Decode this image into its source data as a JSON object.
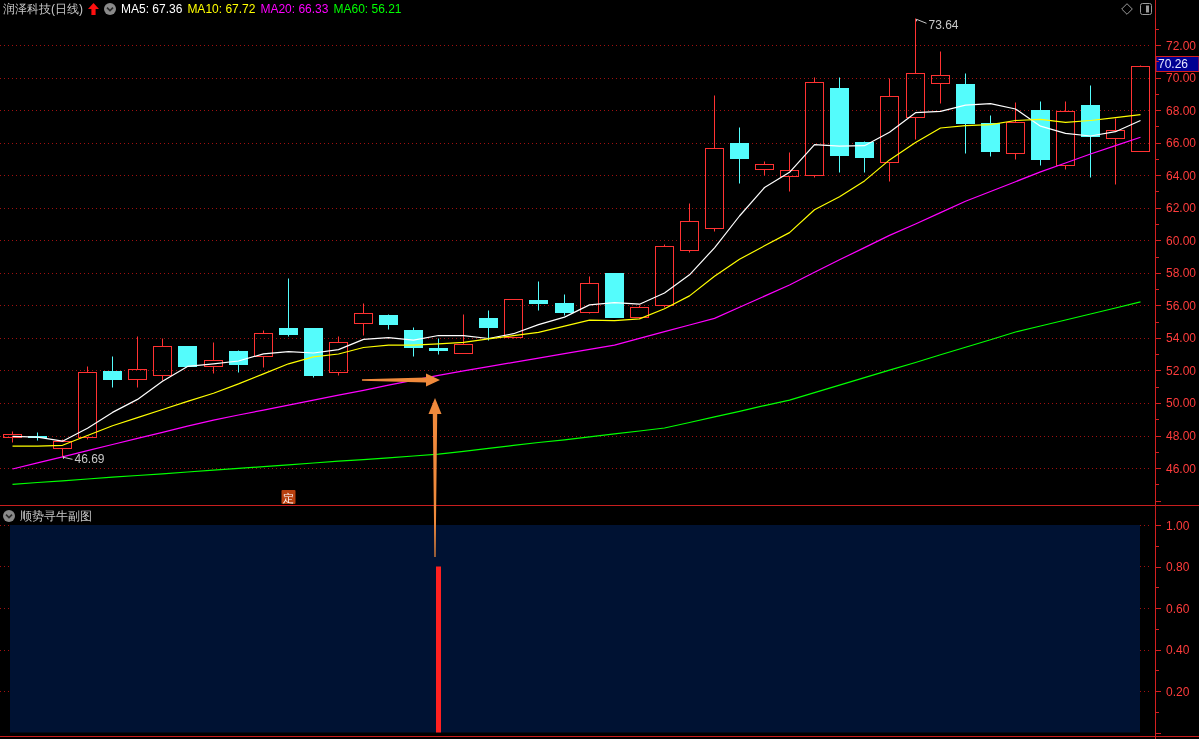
{
  "header": {
    "title": "润泽科技(日线)",
    "indicators": [
      {
        "label": "MA5: 67.36",
        "color": "#ffffff"
      },
      {
        "label": "MA10: 67.72",
        "color": "#ffff00"
      },
      {
        "label": "MA20: 66.33",
        "color": "#ff00ff"
      },
      {
        "label": "MA60: 56.21",
        "color": "#00ff00"
      }
    ]
  },
  "main_chart": {
    "chart_data": {
      "type": "candlestick",
      "grid": true,
      "ylim": [
        43.73,
        73.66
      ],
      "yticks": [
        {
          "value": 72,
          "label": "72.00"
        },
        {
          "value": 70,
          "label": "70.00"
        },
        {
          "value": 68,
          "label": "68.00"
        },
        {
          "value": 66,
          "label": "66.00"
        },
        {
          "value": 64,
          "label": "64.00"
        },
        {
          "value": 62,
          "label": "62.00"
        },
        {
          "value": 60,
          "label": "60.00"
        },
        {
          "value": 58,
          "label": "58.00"
        },
        {
          "value": 56,
          "label": "56.00"
        },
        {
          "value": 54,
          "label": "54.00"
        },
        {
          "value": 52,
          "label": "52.00"
        },
        {
          "value": 50,
          "label": "50.00"
        },
        {
          "value": 48,
          "label": "48.00"
        },
        {
          "value": 46,
          "label": "46.00"
        }
      ],
      "ohlc": [
        [
          47.9,
          48.3,
          47.6,
          48.1
        ],
        [
          48.0,
          48.2,
          47.7,
          47.95
        ],
        [
          47.25,
          47.8,
          46.69,
          47.65
        ],
        [
          47.9,
          52.3,
          47.8,
          51.9
        ],
        [
          51.95,
          52.9,
          51.0,
          51.5
        ],
        [
          51.5,
          54.1,
          51.0,
          52.1
        ],
        [
          51.7,
          54.0,
          51.4,
          53.5
        ],
        [
          53.5,
          53.5,
          52.27,
          52.27
        ],
        [
          52.27,
          53.74,
          51.84,
          52.64
        ],
        [
          53.2,
          53.25,
          51.9,
          52.4
        ],
        [
          52.9,
          54.48,
          52.2,
          54.3
        ],
        [
          54.6,
          57.68,
          54.1,
          54.24
        ],
        [
          54.6,
          54.6,
          51.6,
          51.7
        ],
        [
          51.9,
          54.1,
          51.7,
          53.74
        ],
        [
          54.94,
          56.14,
          54.17,
          55.53
        ],
        [
          55.4,
          55.45,
          54.55,
          54.85
        ],
        [
          54.5,
          54.66,
          52.9,
          53.45
        ],
        [
          53.35,
          54.0,
          53.0,
          53.28
        ],
        [
          53.1,
          55.47,
          53.05,
          53.62
        ],
        [
          55.2,
          55.7,
          53.87,
          54.67
        ],
        [
          54.05,
          56.4,
          54.0,
          56.4
        ],
        [
          56.35,
          57.5,
          55.74,
          56.17
        ],
        [
          56.14,
          56.7,
          55.4,
          55.6
        ],
        [
          55.6,
          57.8,
          55.5,
          57.37
        ],
        [
          57.98,
          58.0,
          55.3,
          55.3
        ],
        [
          55.28,
          56.0,
          55.2,
          55.91
        ],
        [
          56.0,
          59.8,
          55.9,
          59.64
        ],
        [
          59.4,
          62.3,
          59.3,
          61.18
        ],
        [
          60.75,
          68.9,
          60.6,
          65.67
        ],
        [
          65.98,
          66.96,
          63.5,
          65.05
        ],
        [
          64.38,
          64.9,
          64.0,
          64.68
        ],
        [
          63.95,
          65.4,
          63.0,
          64.3
        ],
        [
          64.0,
          70.03,
          63.9,
          69.7
        ],
        [
          69.36,
          70.03,
          64.2,
          65.24
        ],
        [
          66.04,
          66.1,
          64.2,
          65.12
        ],
        [
          64.79,
          69.99,
          63.64,
          68.84
        ],
        [
          67.55,
          73.64,
          66.24,
          70.28
        ],
        [
          69.64,
          71.63,
          68.41,
          70.13
        ],
        [
          69.6,
          70.3,
          65.38,
          67.2
        ],
        [
          67.2,
          67.7,
          65.18,
          65.48
        ],
        [
          65.38,
          68.5,
          65.0,
          67.25
        ],
        [
          68.0,
          68.56,
          64.64,
          65.0
        ],
        [
          64.6,
          68.56,
          64.4,
          67.92
        ],
        [
          68.31,
          69.54,
          63.9,
          66.4
        ],
        [
          66.26,
          67.5,
          63.44,
          66.77
        ],
        [
          65.47,
          70.75,
          65.47,
          70.7
        ]
      ],
      "series": [
        {
          "type": "line",
          "color": "#ffffff",
          "values": [
            47.95,
            47.9,
            47.65,
            48.45,
            49.42,
            50.22,
            51.33,
            52.25,
            52.4,
            52.58,
            53.02,
            53.16,
            53.07,
            53.28,
            53.91,
            54.02,
            53.86,
            54.15,
            54.14,
            53.96,
            54.26,
            54.82,
            55.28,
            56.03,
            56.16,
            56.07,
            56.76,
            57.88,
            59.54,
            61.49,
            63.24,
            64.18,
            65.88,
            65.79,
            65.81,
            66.64,
            67.84,
            67.92,
            68.31,
            68.39,
            68.07,
            67.01,
            66.57,
            66.41,
            66.67,
            67.36
          ]
        },
        {
          "type": "line",
          "color": "#ffff00",
          "values": [
            47.35,
            47.35,
            47.4,
            48.0,
            48.6,
            49.1,
            49.6,
            50.1,
            50.6,
            51.17,
            51.79,
            52.41,
            52.83,
            53.01,
            53.41,
            53.56,
            53.55,
            53.64,
            53.73,
            53.94,
            54.14,
            54.34,
            54.72,
            55.09,
            55.06,
            55.17,
            55.79,
            56.58,
            57.79,
            58.83,
            59.66,
            60.47,
            61.88,
            62.67,
            63.65,
            64.94,
            66.01,
            66.9,
            67.05,
            67.1,
            67.36,
            67.43,
            67.25,
            67.36,
            67.53,
            67.72
          ]
        },
        {
          "type": "line",
          "color": "#ff00ff",
          "values": [
            45.94,
            46.32,
            46.69,
            47.07,
            47.45,
            47.83,
            48.2,
            48.58,
            48.95,
            49.26,
            49.56,
            49.87,
            50.17,
            50.48,
            50.78,
            51.09,
            null,
            51.7,
            51.97,
            52.23,
            52.5,
            52.76,
            53.03,
            53.3,
            53.56,
            53.97,
            54.38,
            54.79,
            55.2,
            55.88,
            56.57,
            57.25,
            58.03,
            58.8,
            59.55,
            60.3,
            61.0,
            61.7,
            62.4,
            63.0,
            63.6,
            64.2,
            64.75,
            65.3,
            65.82,
            66.33
          ]
        },
        {
          "type": "line",
          "color": "#00ff00",
          "values": [
            45.0,
            45.11,
            45.22,
            45.33,
            45.44,
            45.54,
            45.65,
            45.76,
            45.87,
            45.98,
            46.09,
            46.2,
            46.31,
            46.42,
            46.52,
            46.63,
            46.74,
            46.85,
            47.03,
            47.21,
            47.39,
            47.57,
            47.74,
            47.92,
            48.1,
            48.28,
            48.46,
            48.8,
            49.15,
            49.49,
            49.84,
            50.18,
            50.64,
            51.1,
            51.56,
            52.02,
            52.49,
            52.96,
            53.42,
            53.89,
            54.36,
            54.73,
            55.1,
            55.47,
            55.84,
            56.21
          ]
        }
      ]
    },
    "high_label": "73.64",
    "low_label": "46.69",
    "price_tag": "70.26",
    "marker_tag": "定"
  },
  "sub_chart": {
    "title": "顺势寻牛副图",
    "chart_data": {
      "type": "bar",
      "grid": true,
      "ylim": [
        0,
        1
      ],
      "yticks": [
        {
          "value": 1,
          "label": "1.00"
        },
        {
          "value": 0.8,
          "label": "0.80"
        },
        {
          "value": 0.6,
          "label": "0.60"
        },
        {
          "value": 0.4,
          "label": "0.40"
        },
        {
          "value": 0.2,
          "label": "0.20"
        }
      ],
      "series": [
        {
          "color": "#ff2020",
          "values": [
            null,
            null,
            null,
            null,
            null,
            null,
            null,
            null,
            null,
            null,
            null,
            null,
            null,
            null,
            null,
            null,
            null,
            0.8,
            null,
            null,
            null,
            null,
            null,
            null,
            null,
            null,
            null,
            null,
            null,
            null,
            null,
            null,
            null,
            null,
            null,
            null,
            null,
            null,
            null,
            null,
            null,
            null,
            null,
            null,
            null,
            null
          ]
        }
      ]
    }
  }
}
